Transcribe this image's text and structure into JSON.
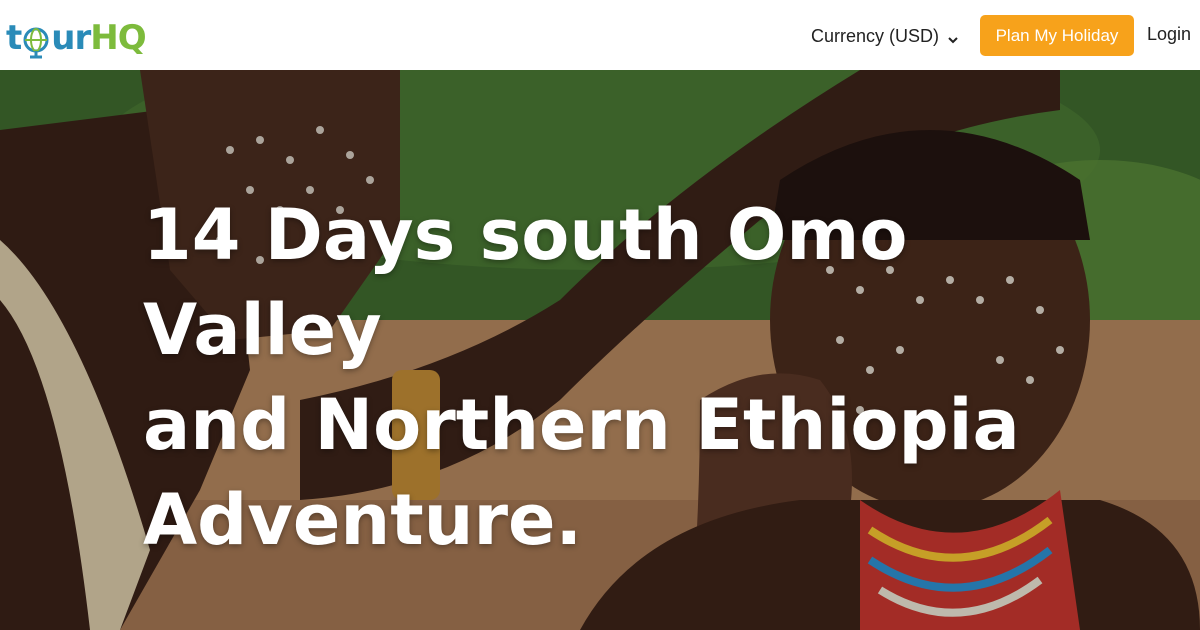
{
  "header": {
    "logo": {
      "part1": "t",
      "part2": "ur",
      "part3": "HQ"
    },
    "currency_label": "Currency (USD)",
    "plan_button": "Plan My Holiday",
    "login": "Login"
  },
  "hero": {
    "title_line1": "14 Days south Omo Valley",
    "title_line2": "and Northern Ethiopia",
    "title_line3": "Adventure."
  },
  "colors": {
    "brand_blue": "#2a8bb8",
    "brand_green": "#7dbb3c",
    "accent_orange": "#f7a21b"
  },
  "icons": {
    "logo_globe": "globe-icon",
    "currency_dropdown": "chevron-down-icon"
  }
}
